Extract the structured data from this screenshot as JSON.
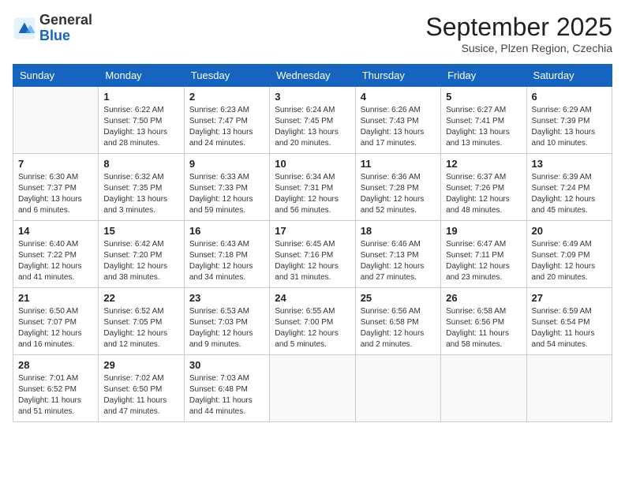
{
  "header": {
    "logo_general": "General",
    "logo_blue": "Blue",
    "month_title": "September 2025",
    "subtitle": "Susice, Plzen Region, Czechia"
  },
  "days_of_week": [
    "Sunday",
    "Monday",
    "Tuesday",
    "Wednesday",
    "Thursday",
    "Friday",
    "Saturday"
  ],
  "weeks": [
    [
      {
        "day": "",
        "info": ""
      },
      {
        "day": "1",
        "info": "Sunrise: 6:22 AM\nSunset: 7:50 PM\nDaylight: 13 hours\nand 28 minutes."
      },
      {
        "day": "2",
        "info": "Sunrise: 6:23 AM\nSunset: 7:47 PM\nDaylight: 13 hours\nand 24 minutes."
      },
      {
        "day": "3",
        "info": "Sunrise: 6:24 AM\nSunset: 7:45 PM\nDaylight: 13 hours\nand 20 minutes."
      },
      {
        "day": "4",
        "info": "Sunrise: 6:26 AM\nSunset: 7:43 PM\nDaylight: 13 hours\nand 17 minutes."
      },
      {
        "day": "5",
        "info": "Sunrise: 6:27 AM\nSunset: 7:41 PM\nDaylight: 13 hours\nand 13 minutes."
      },
      {
        "day": "6",
        "info": "Sunrise: 6:29 AM\nSunset: 7:39 PM\nDaylight: 13 hours\nand 10 minutes."
      }
    ],
    [
      {
        "day": "7",
        "info": "Sunrise: 6:30 AM\nSunset: 7:37 PM\nDaylight: 13 hours\nand 6 minutes."
      },
      {
        "day": "8",
        "info": "Sunrise: 6:32 AM\nSunset: 7:35 PM\nDaylight: 13 hours\nand 3 minutes."
      },
      {
        "day": "9",
        "info": "Sunrise: 6:33 AM\nSunset: 7:33 PM\nDaylight: 12 hours\nand 59 minutes."
      },
      {
        "day": "10",
        "info": "Sunrise: 6:34 AM\nSunset: 7:31 PM\nDaylight: 12 hours\nand 56 minutes."
      },
      {
        "day": "11",
        "info": "Sunrise: 6:36 AM\nSunset: 7:28 PM\nDaylight: 12 hours\nand 52 minutes."
      },
      {
        "day": "12",
        "info": "Sunrise: 6:37 AM\nSunset: 7:26 PM\nDaylight: 12 hours\nand 48 minutes."
      },
      {
        "day": "13",
        "info": "Sunrise: 6:39 AM\nSunset: 7:24 PM\nDaylight: 12 hours\nand 45 minutes."
      }
    ],
    [
      {
        "day": "14",
        "info": "Sunrise: 6:40 AM\nSunset: 7:22 PM\nDaylight: 12 hours\nand 41 minutes."
      },
      {
        "day": "15",
        "info": "Sunrise: 6:42 AM\nSunset: 7:20 PM\nDaylight: 12 hours\nand 38 minutes."
      },
      {
        "day": "16",
        "info": "Sunrise: 6:43 AM\nSunset: 7:18 PM\nDaylight: 12 hours\nand 34 minutes."
      },
      {
        "day": "17",
        "info": "Sunrise: 6:45 AM\nSunset: 7:16 PM\nDaylight: 12 hours\nand 31 minutes."
      },
      {
        "day": "18",
        "info": "Sunrise: 6:46 AM\nSunset: 7:13 PM\nDaylight: 12 hours\nand 27 minutes."
      },
      {
        "day": "19",
        "info": "Sunrise: 6:47 AM\nSunset: 7:11 PM\nDaylight: 12 hours\nand 23 minutes."
      },
      {
        "day": "20",
        "info": "Sunrise: 6:49 AM\nSunset: 7:09 PM\nDaylight: 12 hours\nand 20 minutes."
      }
    ],
    [
      {
        "day": "21",
        "info": "Sunrise: 6:50 AM\nSunset: 7:07 PM\nDaylight: 12 hours\nand 16 minutes."
      },
      {
        "day": "22",
        "info": "Sunrise: 6:52 AM\nSunset: 7:05 PM\nDaylight: 12 hours\nand 12 minutes."
      },
      {
        "day": "23",
        "info": "Sunrise: 6:53 AM\nSunset: 7:03 PM\nDaylight: 12 hours\nand 9 minutes."
      },
      {
        "day": "24",
        "info": "Sunrise: 6:55 AM\nSunset: 7:00 PM\nDaylight: 12 hours\nand 5 minutes."
      },
      {
        "day": "25",
        "info": "Sunrise: 6:56 AM\nSunset: 6:58 PM\nDaylight: 12 hours\nand 2 minutes."
      },
      {
        "day": "26",
        "info": "Sunrise: 6:58 AM\nSunset: 6:56 PM\nDaylight: 11 hours\nand 58 minutes."
      },
      {
        "day": "27",
        "info": "Sunrise: 6:59 AM\nSunset: 6:54 PM\nDaylight: 11 hours\nand 54 minutes."
      }
    ],
    [
      {
        "day": "28",
        "info": "Sunrise: 7:01 AM\nSunset: 6:52 PM\nDaylight: 11 hours\nand 51 minutes."
      },
      {
        "day": "29",
        "info": "Sunrise: 7:02 AM\nSunset: 6:50 PM\nDaylight: 11 hours\nand 47 minutes."
      },
      {
        "day": "30",
        "info": "Sunrise: 7:03 AM\nSunset: 6:48 PM\nDaylight: 11 hours\nand 44 minutes."
      },
      {
        "day": "",
        "info": ""
      },
      {
        "day": "",
        "info": ""
      },
      {
        "day": "",
        "info": ""
      },
      {
        "day": "",
        "info": ""
      }
    ]
  ]
}
